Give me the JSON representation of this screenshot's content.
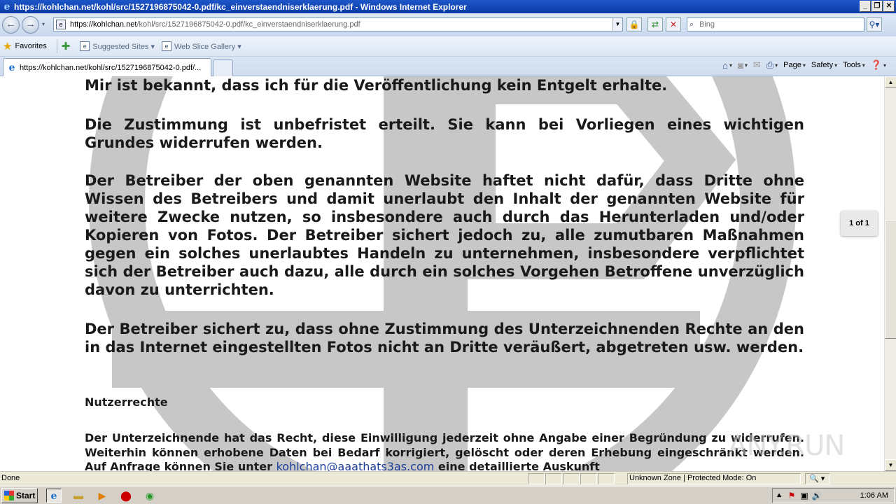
{
  "window": {
    "title": "https://kohlchan.net/kohl/src/1527196875042-0.pdf/kc_einverstaendniserklaerung.pdf - Windows Internet Explorer",
    "btn_min": "_",
    "btn_max": "❐",
    "btn_close": "✕"
  },
  "address": {
    "host": "https://kohlchan.net",
    "path": "/kohl/src/1527196875042-0.pdf/kc_einverstaendniserklaerung.pdf"
  },
  "search": {
    "placeholder": "Bing"
  },
  "favorites_bar": {
    "favorites_label": "Favorites",
    "links": [
      {
        "label": "Suggested Sites ▾"
      },
      {
        "label": "Web Slice Gallery ▾"
      }
    ]
  },
  "tab": {
    "label": "https://kohlchan.net/kohl/src/1527196875042-0.pdf/..."
  },
  "command_bar": {
    "page_label": "Page",
    "safety_label": "Safety",
    "tools_label": "Tools"
  },
  "document": {
    "p1": "Mir ist bekannt, dass ich für die Veröffentlichung kein Entgelt erhalte.",
    "p2": "Die Zustimmung ist unbefristet erteilt. Sie kann bei Vorliegen eines wichtigen Grundes widerrufen werden.",
    "p3": "Der Betreiber der oben genannten Website haftet nicht dafür, dass Dritte ohne Wissen des Betreibers und damit unerlaubt den Inhalt der genannten Website für weitere Zwecke nutzen, so insbesondere auch durch das Herunterladen und/oder Kopieren von Fotos. Der Betreiber sichert jedoch zu, alle zumutbaren Maßnahmen gegen ein solches unerlaubtes Handeln zu unternehmen, insbesondere verpflichtet sich der Betreiber auch dazu, alle durch ein solches Vorgehen Betroffene unverzüglich davon zu unterrichten.",
    "p4": "Der Betreiber sichert zu, dass ohne Zustimmung des Unterzeichnenden Rechte an den in das Internet eingestellten Fotos nicht an Dritte veräußert, abgetreten usw. werden.",
    "heading": "Nutzerrechte",
    "p5_before": "Der Unterzeichnende hat das Recht, diese Einwilligung jederzeit ohne Angabe einer Begründung zu widerrufen. Weiterhin können erhobene Daten bei Bedarf korrigiert, gelöscht oder deren Erhebung eingeschränkt werden. Auf Anfrage können Sie unter ",
    "p5_email": "kohlchan@aaathats3as.com",
    "p5_after": " eine detaillierte Auskunft"
  },
  "page_indicator": "1 of 1",
  "watermark_text": "ANY.RUN",
  "status": {
    "left": "Done",
    "zone": "Unknown Zone | Protected Mode: On",
    "zoom": "🔍 ▾"
  },
  "taskbar": {
    "start_label": "Start",
    "clock": "1:06 AM"
  }
}
